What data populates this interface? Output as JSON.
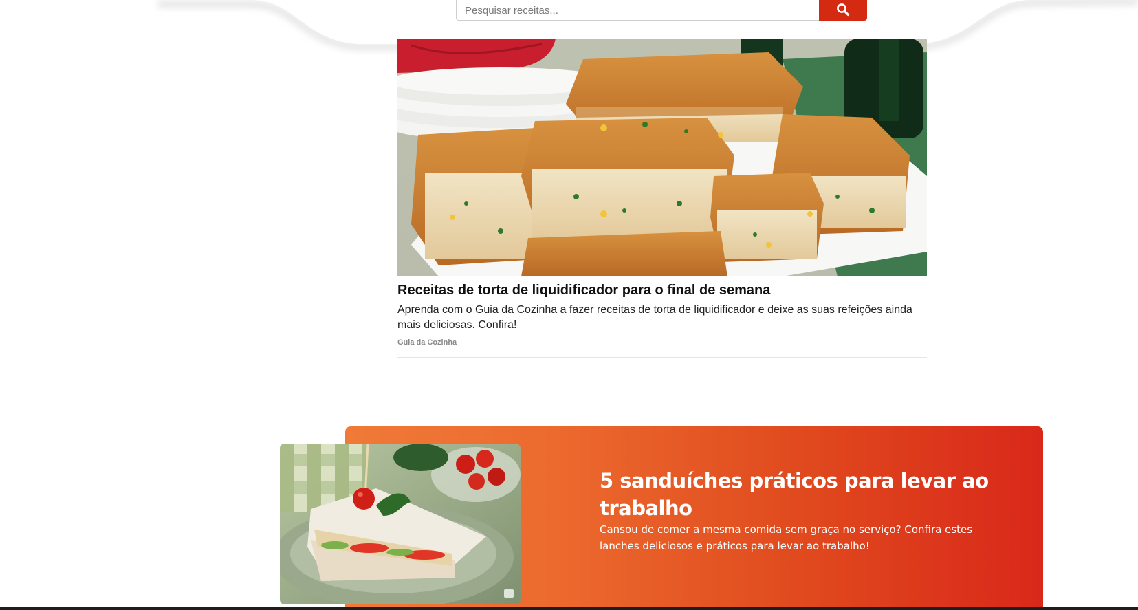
{
  "search": {
    "placeholder": "Pesquisar receitas...",
    "value": "",
    "icon": "search-icon"
  },
  "article": {
    "image_alt": "Torta de liquidificador cortada em quadrados",
    "title": "Receitas de torta de liquidificador para o final de semana",
    "description": "Aprenda com o Guia da Cozinha a fazer receitas de torta de liquidificador e deixe as suas refeições ainda mais deliciosas. Confira!",
    "source": "Guia da Cozinha"
  },
  "promo": {
    "image_alt": "Sanduíche natural de frango com tomate",
    "title": "5 sanduíches práticos para levar ao trabalho",
    "description": "Cansou de comer a mesma comida sem graça no serviço? Confira estes lanches deliciosos e práticos para levar ao trabalho!"
  },
  "colors": {
    "accent": "#d42a12",
    "banner_start": "#f07a38",
    "banner_end": "#d9281a"
  }
}
